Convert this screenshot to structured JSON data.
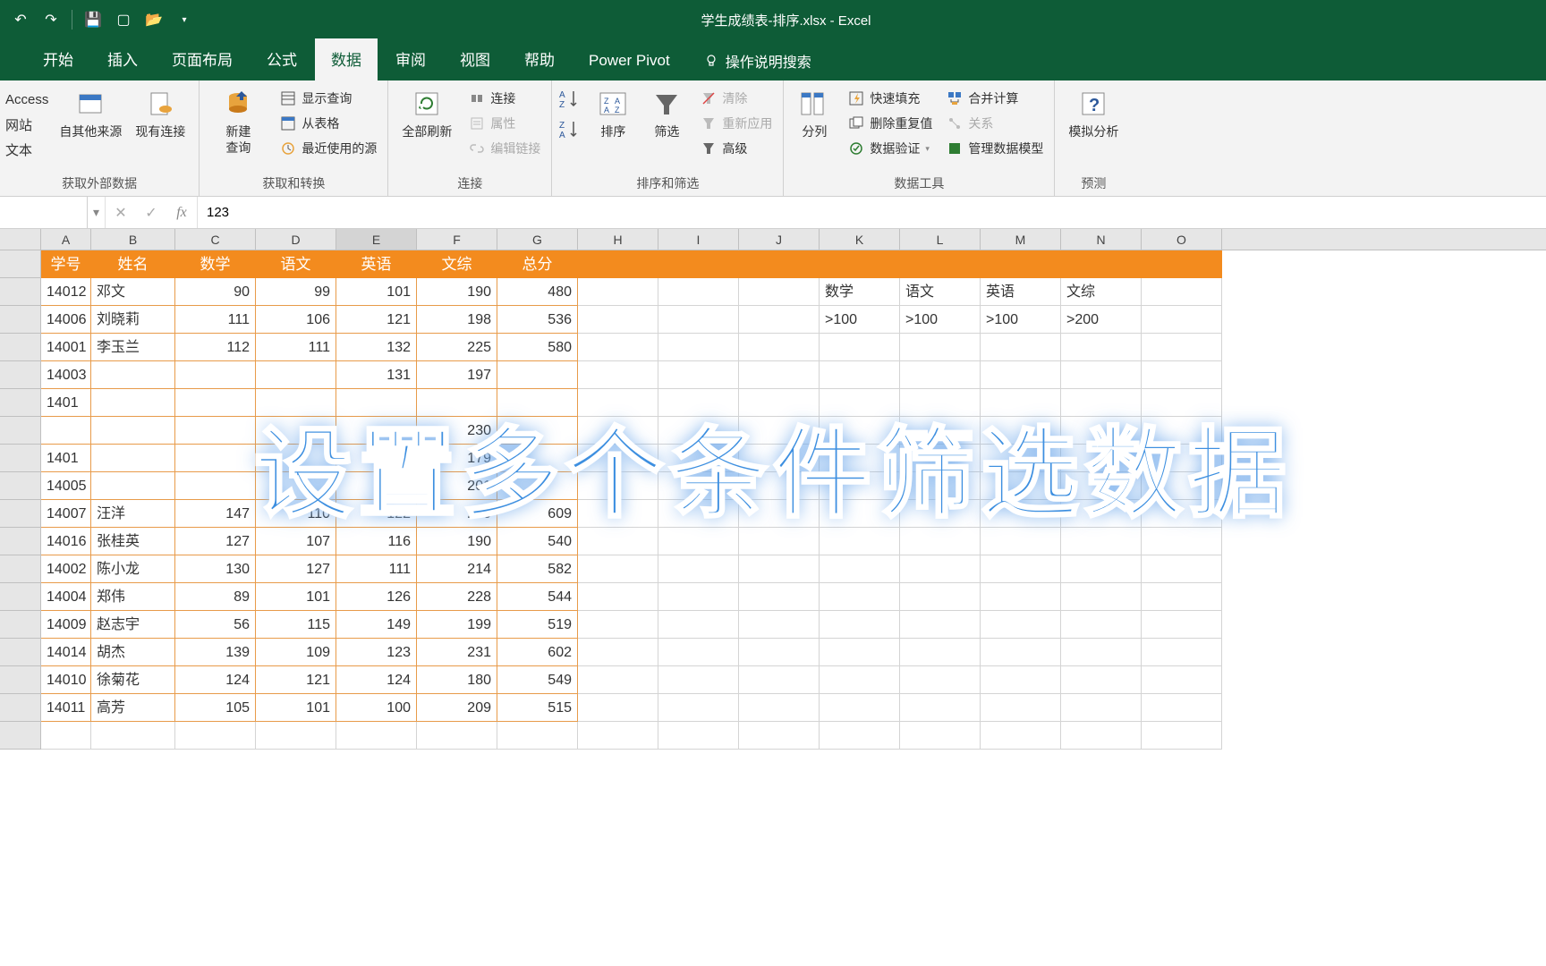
{
  "titlebar": {
    "title": "学生成绩表-排序.xlsx  -  Excel"
  },
  "tabs": {
    "start": "开始",
    "insert": "插入",
    "layout": "页面布局",
    "formula": "公式",
    "data": "数据",
    "review": "审阅",
    "view": "视图",
    "help": "帮助",
    "powerpivot": "Power Pivot",
    "tellme": "操作说明搜索"
  },
  "ribbon": {
    "ext_group_left": {
      "line1": "Access",
      "line2": "网站",
      "line3": "文本"
    },
    "from_other": "自其他来源",
    "existing_conn": "现有连接",
    "group_external": "获取外部数据",
    "new_query": "新建\n查询",
    "show_query": "显示查询",
    "from_table": "从表格",
    "recent_sources": "最近使用的源",
    "group_transform": "获取和转换",
    "refresh_all": "全部刷新",
    "connections": "连接",
    "properties": "属性",
    "edit_links": "编辑链接",
    "group_conn": "连接",
    "sort": "排序",
    "filter": "筛选",
    "clear": "清除",
    "reapply": "重新应用",
    "advanced": "高级",
    "group_sortfilter": "排序和筛选",
    "text_to_cols": "分列",
    "flash_fill": "快速填充",
    "remove_dup": "删除重复值",
    "data_valid": "数据验证",
    "consolidate": "合并计算",
    "relations": "关系",
    "manage_model": "管理数据模型",
    "group_tools": "数据工具",
    "whatif": "模拟分析",
    "group_forecast": "预测"
  },
  "formula_bar": {
    "name_box": "",
    "value": "123"
  },
  "columns": [
    "A",
    "B",
    "C",
    "D",
    "E",
    "F",
    "G",
    "H",
    "I",
    "J",
    "K",
    "L",
    "M",
    "N",
    "O"
  ],
  "headers": {
    "id": "学号",
    "name": "姓名",
    "math": "数学",
    "chinese": "语文",
    "english": "英语",
    "arts": "文综",
    "total": "总分"
  },
  "rows": [
    {
      "id": "14012",
      "name": "邓文",
      "math": 90,
      "chinese": 99,
      "english": 101,
      "arts": 190,
      "total": 480
    },
    {
      "id": "14006",
      "name": "刘晓莉",
      "math": 111,
      "chinese": 106,
      "english": 121,
      "arts": 198,
      "total": 536
    },
    {
      "id": "14001",
      "name": "李玉兰",
      "math": 112,
      "chinese": 111,
      "english": 132,
      "arts": 225,
      "total": 580
    },
    {
      "id": "14003",
      "name": "",
      "math": "",
      "chinese": "",
      "english": 131,
      "arts": 197,
      "total": ""
    },
    {
      "id": "1401",
      "name": "",
      "math": "",
      "chinese": "",
      "english": "",
      "arts": "",
      "total": ""
    },
    {
      "id": "",
      "name": "",
      "math": "",
      "chinese": "",
      "english": "",
      "arts": 230,
      "total": ""
    },
    {
      "id": "1401",
      "name": "",
      "math": "",
      "chinese": "",
      "english": 129,
      "arts": 179,
      "total": ""
    },
    {
      "id": "14005",
      "name": "",
      "math": "",
      "chinese": "",
      "english": 113,
      "arts": 201,
      "total": ""
    },
    {
      "id": "14007",
      "name": "汪洋",
      "math": 147,
      "chinese": 110,
      "english": 122,
      "arts": 230,
      "total": 609
    },
    {
      "id": "14016",
      "name": "张桂英",
      "math": 127,
      "chinese": 107,
      "english": 116,
      "arts": 190,
      "total": 540
    },
    {
      "id": "14002",
      "name": "陈小龙",
      "math": 130,
      "chinese": 127,
      "english": 111,
      "arts": 214,
      "total": 582
    },
    {
      "id": "14004",
      "name": "郑伟",
      "math": 89,
      "chinese": 101,
      "english": 126,
      "arts": 228,
      "total": 544
    },
    {
      "id": "14009",
      "name": "赵志宇",
      "math": 56,
      "chinese": 115,
      "english": 149,
      "arts": 199,
      "total": 519
    },
    {
      "id": "14014",
      "name": "胡杰",
      "math": 139,
      "chinese": 109,
      "english": 123,
      "arts": 231,
      "total": 602
    },
    {
      "id": "14010",
      "name": "徐菊花",
      "math": 124,
      "chinese": 121,
      "english": 124,
      "arts": 180,
      "total": 549
    },
    {
      "id": "14011",
      "name": "高芳",
      "math": 105,
      "chinese": 101,
      "english": 100,
      "arts": 209,
      "total": 515
    }
  ],
  "criteria": {
    "headers": {
      "math": "数学",
      "chinese": "语文",
      "english": "英语",
      "arts": "文综"
    },
    "values": {
      "math": ">100",
      "chinese": ">100",
      "english": ">100",
      "arts": ">200"
    }
  },
  "overlay": "设置多个条件筛选数据"
}
